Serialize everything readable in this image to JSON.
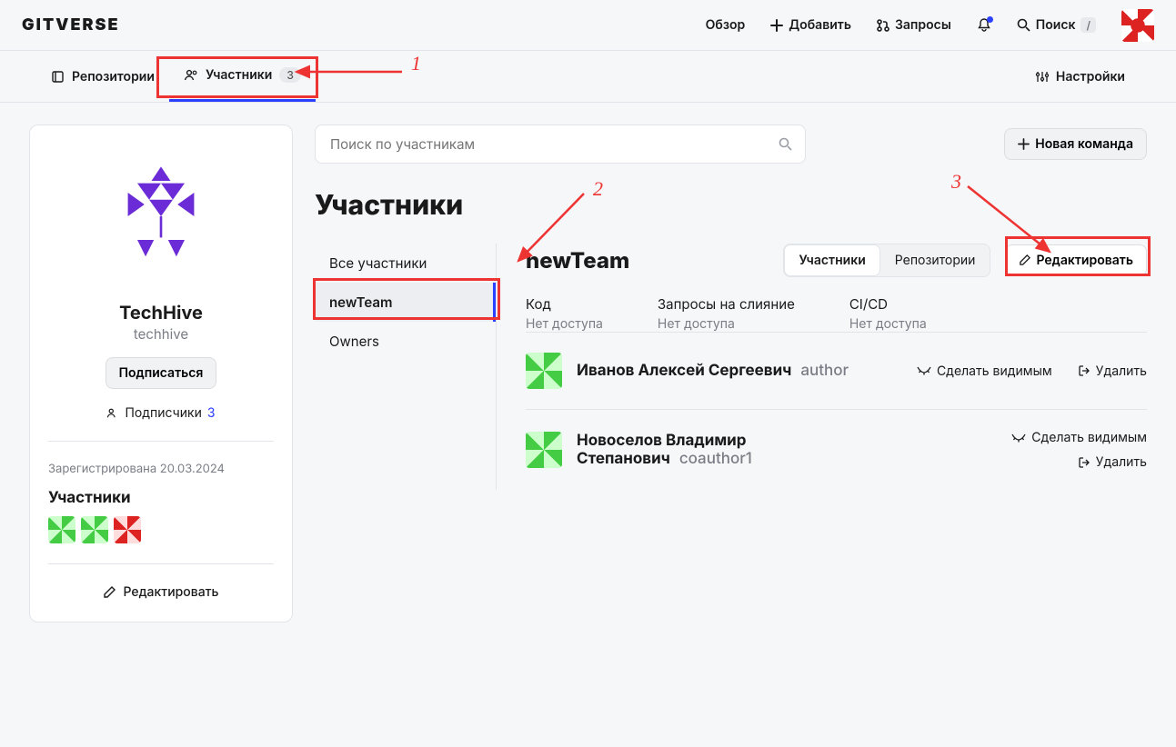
{
  "header": {
    "logo": "GITVERSE",
    "nav": {
      "overview": "Обзор",
      "add": "Добавить",
      "requests": "Запросы",
      "search": "Поиск",
      "search_kbd": "/"
    }
  },
  "tabs": {
    "repos": "Репозитории",
    "members": "Участники",
    "members_count": "3",
    "settings": "Настройки"
  },
  "org": {
    "name": "TechHive",
    "slug": "techhive",
    "subscribe": "Подписаться",
    "followers_label": "Подписчики",
    "followers_count": "3",
    "registered": "Зарегистрирована 20.03.2024",
    "members_heading": "Участники",
    "edit": "Редактировать"
  },
  "content": {
    "search_placeholder": "Поиск по участникам",
    "new_team": "Новая команда",
    "heading": "Участники",
    "teams": {
      "all": "Все участники",
      "newTeam": "newTeam",
      "owners": "Owners"
    },
    "detail": {
      "title": "newTeam",
      "seg_members": "Участники",
      "seg_repos": "Репозитории",
      "edit": "Редактировать",
      "perms": {
        "code_label": "Код",
        "code_val": "Нет доступа",
        "merge_label": "Запросы на слияние",
        "merge_val": "Нет доступа",
        "cicd_label": "CI/CD",
        "cicd_val": "Нет доступа"
      },
      "members": [
        {
          "name": "Иванов Алексей Сергеевич",
          "login": "author",
          "visible": "Сделать видимым",
          "delete": "Удалить"
        },
        {
          "name": "Новоселов Владимир Степанович",
          "login": "coauthor1",
          "visible": "Сделать видимым",
          "delete": "Удалить"
        }
      ]
    }
  },
  "annotations": {
    "n1": "1",
    "n2": "2",
    "n3": "3"
  }
}
